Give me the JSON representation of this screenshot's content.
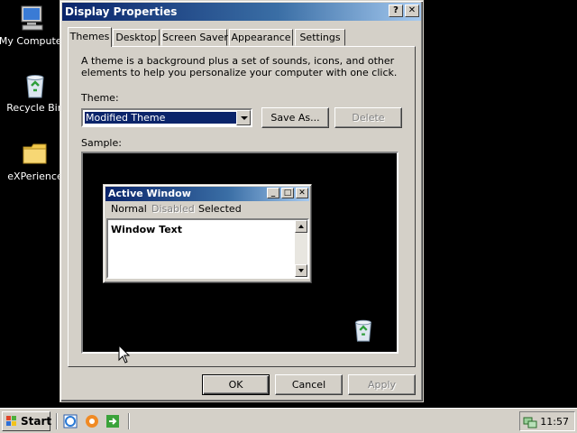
{
  "desktop": {
    "icons": [
      {
        "label": "My Computer",
        "icon": "my-computer-icon"
      },
      {
        "label": "Recycle Bin",
        "icon": "recycle-bin-icon"
      },
      {
        "label": "eXPerience",
        "icon": "folder-icon"
      }
    ]
  },
  "dialog": {
    "title": "Display Properties",
    "help_button": "?",
    "close_button": "✕",
    "tabs": [
      "Themes",
      "Desktop",
      "Screen Saver",
      "Appearance",
      "Settings"
    ],
    "active_tab": "Themes",
    "description": "A theme is a background plus a set of sounds, icons, and other elements to help you personalize your computer with one click.",
    "theme_label": "Theme:",
    "theme_value": "Modified Theme",
    "save_as_label": "Save As...",
    "delete_label": "Delete",
    "sample_label": "Sample:",
    "sample": {
      "window_title": "Active Window",
      "menu": {
        "normal": "Normal",
        "disabled": "Disabled",
        "selected": "Selected"
      },
      "window_text": "Window Text",
      "min": "_",
      "max": "□",
      "close": "✕"
    },
    "ok_label": "OK",
    "cancel_label": "Cancel",
    "apply_label": "Apply"
  },
  "taskbar": {
    "start_label": "Start",
    "quick_launch": [
      "internet-explorer-icon",
      "media-player-icon",
      "show-desktop-icon"
    ],
    "clock": "11:57"
  },
  "colors": {
    "desktop": "#000000",
    "face": "#d4d0c8",
    "title_active": "#0a246a",
    "title_gradient_end": "#a6caf0",
    "selection": "#0a246a"
  }
}
